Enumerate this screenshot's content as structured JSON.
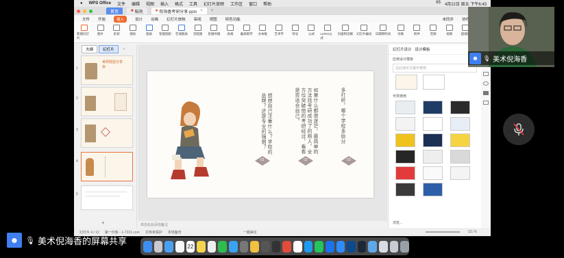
{
  "menubar": {
    "app": "WPS Office",
    "items": [
      "文件",
      "编辑",
      "视图",
      "插入",
      "格式",
      "工具",
      "幻灯片放映",
      "工作区",
      "窗口",
      "帮助"
    ],
    "status": [
      "65",
      "4月22日 周五 下午6:43"
    ]
  },
  "tabs": {
    "home": "首页",
    "template": "稻壳",
    "document": "倪海香考研分享.pptx"
  },
  "ribbon_tabs": {
    "file": "文件",
    "items": [
      "开始",
      "插入",
      "设计",
      "动画",
      "幻灯片放映",
      "审阅",
      "视图",
      "特色功能"
    ],
    "active": "插入",
    "right": [
      "未同步",
      "协作",
      "分享"
    ]
  },
  "ribbon_buttons": [
    "新建幻灯片",
    "图片",
    "形状",
    "图标",
    "图表",
    "智能图形",
    "在线图表",
    "流程图",
    "思维导图",
    "表格",
    "截屏取字",
    "文本框",
    "艺术字",
    "符号",
    "公式",
    "LaTeX公式",
    "页眉和页脚",
    "幻灯片编号",
    "日期和时间",
    "对象",
    "附件",
    "音频",
    "视频",
    "超链接",
    "动作"
  ],
  "thumb_pane": {
    "tabs": [
      "大纲",
      "幻灯片"
    ],
    "slide_numbers": [
      "1",
      "2",
      "3",
      "4",
      "5"
    ],
    "thumb1_text": "考研经验分享会"
  },
  "slide": {
    "col1": "多打听，哪个学校多给分",
    "col2": "如果什么都很迷茫，最简单的方法找考研成功了的熟人，全方位突破他的考研经过，看看是否适合自己。",
    "col3": "想想自己注重什么？学校的品牌？还是专业的强弱？",
    "labels": [
      "01",
      "02",
      "03"
    ]
  },
  "notes_placeholder": "单击此处添加备注",
  "design_panel": {
    "header": "幻灯片设计 · 设计模板",
    "section1": "应用设计模板",
    "search": "在此演示文稿中使用",
    "section2": "可供使用",
    "footer": "浏览..."
  },
  "statusbar": {
    "slide_info": "幻灯片 4 / 12",
    "theme": "第一印象 - 1-7221.com",
    "doc_protect": "文档未保护",
    "backup": "本地备份",
    "beautify": "一键美化",
    "zoom": "111 %"
  },
  "participants": {
    "top": "美术倪海香",
    "bottom": "美术倪海香的屏幕共享"
  },
  "dock": {
    "calendar_date": "22"
  }
}
